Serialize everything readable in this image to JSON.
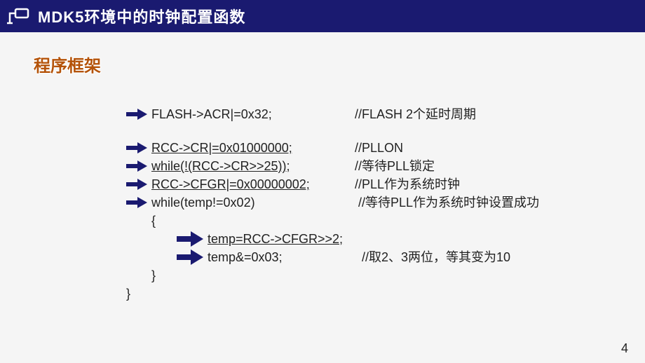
{
  "header": {
    "title": "MDK5环境中的时钟配置函数"
  },
  "subtitle": "程序框架",
  "lines": {
    "l1_code": "FLASH->ACR|=0x32;",
    "l1_comment": "//FLASH 2个延时周期",
    "l2_code": "RCC->CR|=0x01000000;",
    "l2_comment": "//PLLON",
    "l3_code": "while(!(RCC->CR>>25));",
    "l3_comment": "//等待PLL锁定",
    "l4_code": "RCC->CFGR|=0x00000002;",
    "l4_comment": "//PLL作为系统时钟",
    "l5_code": "while(temp!=0x02)",
    "l5_comment": " //等待PLL作为系统时钟设置成功",
    "brace_open": "{",
    "l6_code": "temp=RCC->CFGR>>2;",
    "l7_code": "temp&=0x03;",
    "l7_comment": "//取2、3两位，等其变为10",
    "brace_close": "}",
    "outer_close": "}"
  },
  "page_number": "4"
}
